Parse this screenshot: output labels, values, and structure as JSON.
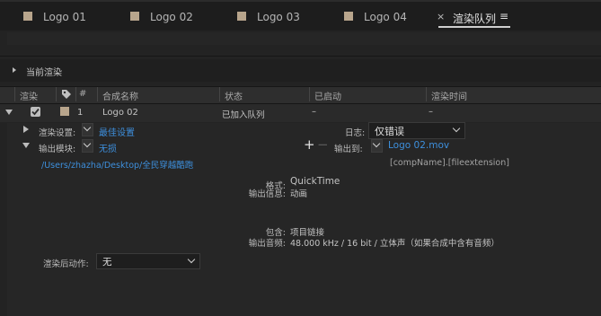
{
  "tabs": [
    {
      "label": "Logo 01",
      "swatch": "#b8a58c"
    },
    {
      "label": "Logo 02",
      "swatch": "#b8a58c"
    },
    {
      "label": "Logo 03",
      "swatch": "#b8a58c"
    },
    {
      "label": "Logo 04",
      "swatch": "#b8a58c"
    },
    {
      "label": "渲染队列",
      "close": "×",
      "menu": "≡"
    }
  ],
  "current_render": {
    "label": "当前渲染"
  },
  "columns": {
    "render": "渲染",
    "num": "#",
    "comp_name": "合成名称",
    "status": "状态",
    "started": "已启动",
    "render_time": "渲染时间"
  },
  "queue_item": {
    "number": "1",
    "comp_name": "Logo 02",
    "status": "已加入队列",
    "started": "–",
    "render_time": "–",
    "checked": true,
    "label_color": "#b8a58c"
  },
  "render_settings": {
    "label": "渲染设置:",
    "value": "最佳设置"
  },
  "log": {
    "label": "日志:",
    "value": "仅错误"
  },
  "output_module": {
    "label": "输出模块:",
    "value": "无损",
    "add": "+",
    "remove": "−"
  },
  "output_to": {
    "label": "输出到:",
    "value": "Logo 02.mov"
  },
  "path": "/Users/zhazha/Desktop/全民穿越酷跑",
  "filename_template": "[compName].[fileextension]",
  "details": {
    "format_label": "格式:",
    "format_value": "QuickTime",
    "output_info_label": "输出信息:",
    "output_info_value": "动画",
    "include_label": "包含:",
    "include_value": "项目链接",
    "audio_label": "输出音频:",
    "audio_value": "48.000 kHz / 16 bit / 立体声（如果合成中含有音频）"
  },
  "post_render": {
    "label": "渲染后动作:",
    "value": "无"
  }
}
